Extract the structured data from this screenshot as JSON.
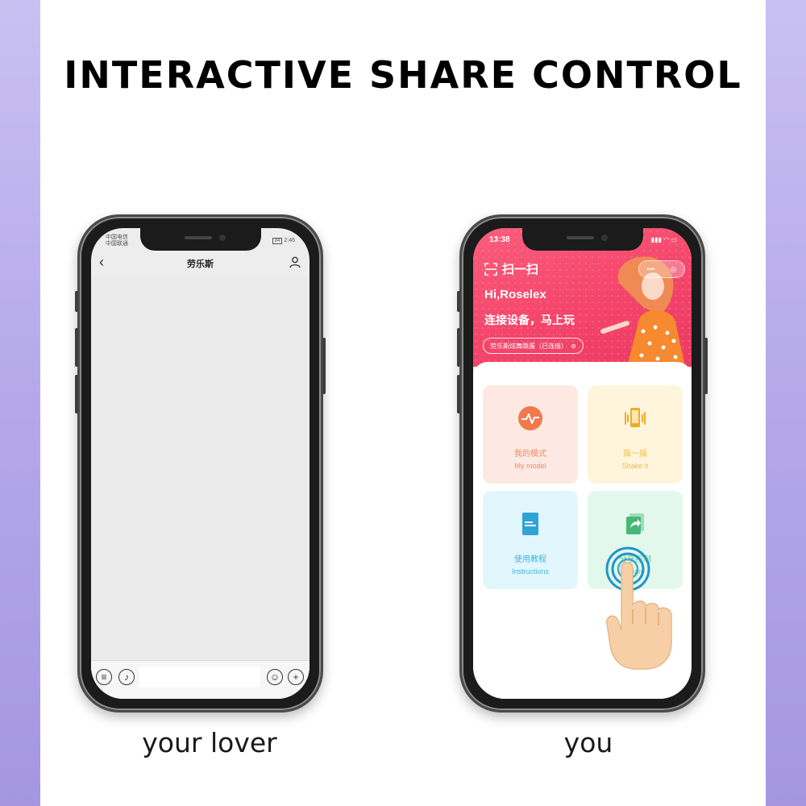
{
  "page": {
    "title": "INTERACTIVE SHARE CONTROL",
    "caption_left": "your lover",
    "caption_right": "you"
  },
  "colors": {
    "side_band": "#b4a8ea",
    "hero_pink": "#f4456a",
    "my_model_tile": "#fde9e1",
    "shake_tile": "#fff5dd",
    "instructions_tile": "#e2f6fd",
    "share_tile": "#e2f8ec"
  },
  "left_phone": {
    "status": {
      "carrier_1": "中国电信",
      "carrier_2": "中国联通",
      "time": "2:46",
      "battery": "84"
    },
    "chat_title": "劳乐斯",
    "icons": [
      "back-chevron-icon",
      "person-icon",
      "list-icon",
      "voice-icon",
      "emoji-icon",
      "plus-icon"
    ]
  },
  "right_phone": {
    "status": {
      "time": "13:38"
    },
    "scan_label": "扫一扫",
    "capsule_label": "•••",
    "greeting": "Hi,Roselex",
    "slogan": "连接设备，马上玩",
    "device_status": "劳乐斯炫舞跳蛋（已连接）",
    "tiles": [
      {
        "cn": "我的模式",
        "en": "My model",
        "icon": "pulse-icon"
      },
      {
        "cn": "摇一摇",
        "en": "Shake it",
        "icon": "shake-phone-icon"
      },
      {
        "cn": "使用教程",
        "en": "Instructions",
        "icon": "book-icon"
      },
      {
        "cn": "分享控制",
        "en": "Share",
        "icon": "share-icon"
      }
    ],
    "overlay_icon": "tapping-hand-icon"
  }
}
